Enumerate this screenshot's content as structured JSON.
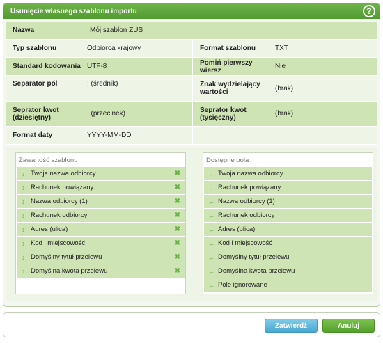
{
  "dialog": {
    "title": "Usunięcie własnego szablonu importu",
    "help": "?"
  },
  "props": {
    "name": {
      "label": "Nazwa",
      "value": "Mój szablon ZUS"
    },
    "type": {
      "label": "Typ szablonu",
      "value": "Odbiorca krajowy"
    },
    "format": {
      "label": "Format szablonu",
      "value": "TXT"
    },
    "encoding": {
      "label": "Standard kodowania",
      "value": "UTF-8"
    },
    "skip_first": {
      "label": "Pomiń pierwszy wiersz",
      "value": "Nie"
    },
    "field_sep": {
      "label": "Separator pól",
      "value": "; (średnik)"
    },
    "quote_char": {
      "label": "Znak wydzielający wartości",
      "value": "(brak)"
    },
    "decimal_sep": {
      "label": "Seprator kwot (dziesiętny)",
      "value": ", (przecinek)"
    },
    "thousand_sep": {
      "label": "Seprator kwot (tysięczny)",
      "value": "(brak)"
    },
    "date_format": {
      "label": "Format daty",
      "value": "YYYY-MM-DD"
    }
  },
  "template_panel": {
    "title": "Zawartość szablonu",
    "items": [
      "Twoja nazwa odbiorcy",
      "Rachunek powiązany",
      "Nazwa odbiorcy (1)",
      "Rachunek odbiorcy",
      "Adres (ulica)",
      "Kod i miejscowość",
      "Domyślny tytuł przelewu",
      "Domyślna kwota przelewu"
    ]
  },
  "available_panel": {
    "title": "Dostępne pola",
    "items": [
      "Twoja nazwa odbiorcy",
      "Rachunek powiązany",
      "Nazwa odbiorcy (1)",
      "Rachunek odbiorcy",
      "Adres (ulica)",
      "Kod i miejscowość",
      "Domyślny tytuł przelewu",
      "Domyślna kwota przelewu",
      "Pole ignorowane"
    ]
  },
  "icons": {
    "drag": "↕",
    "remove": "✖",
    "add": "←"
  },
  "buttons": {
    "confirm": "Zatwierdź",
    "cancel": "Anuluj"
  },
  "colors": {
    "accent_green": "#5aa538",
    "row_shade": "#cfe4b5",
    "confirm_blue": "#4aa8d2"
  }
}
